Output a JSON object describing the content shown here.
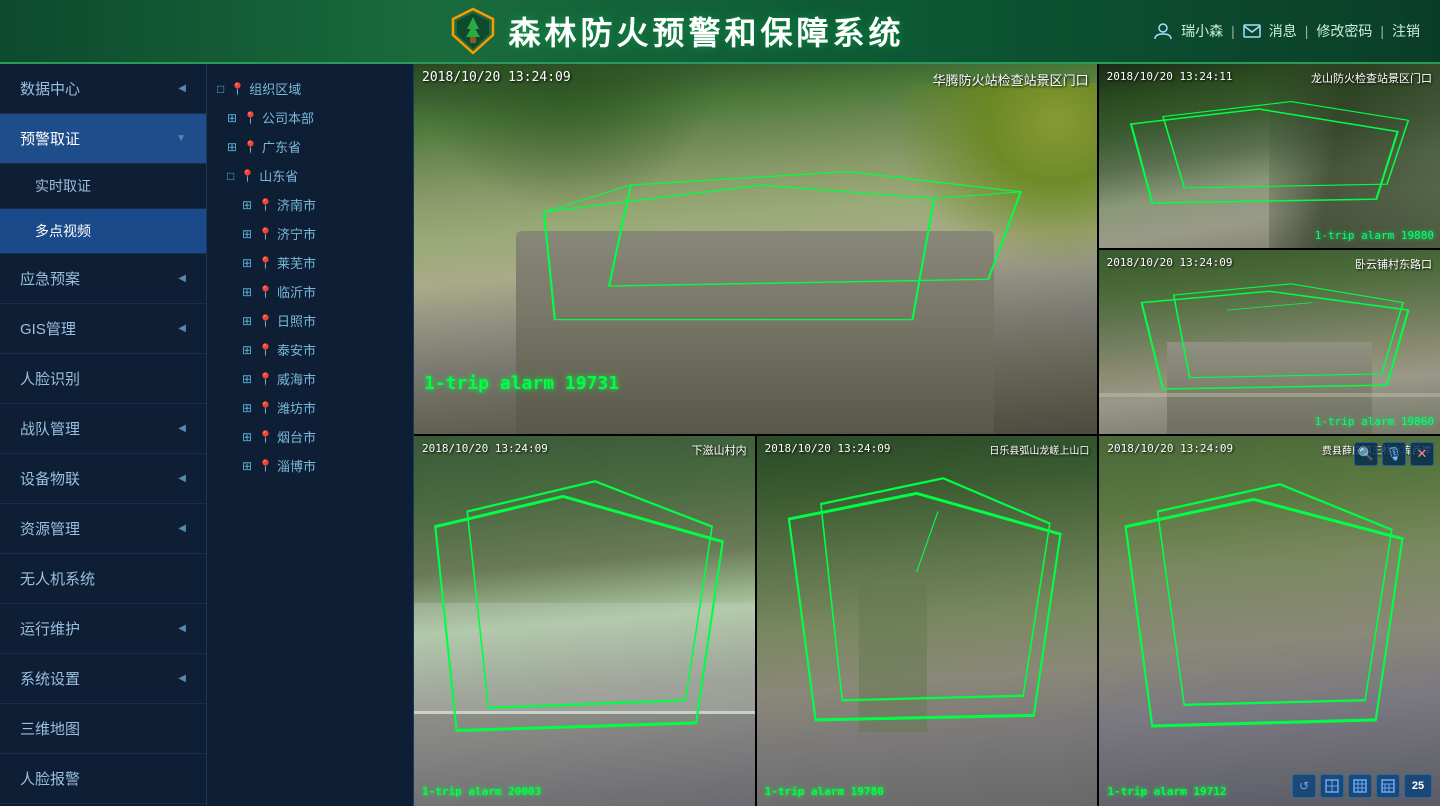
{
  "header": {
    "title": "森林防火预警和保障系统",
    "user": "瑞小森",
    "messages": "消息",
    "change_pwd": "修改密码",
    "logout": "注销"
  },
  "sidebar": {
    "items": [
      {
        "label": "数据中心",
        "arrow": "◀",
        "active": false
      },
      {
        "label": "预警取证",
        "arrow": "▼",
        "active": true
      },
      {
        "label": "实时取证",
        "arrow": "",
        "active": false,
        "sub": true
      },
      {
        "label": "多点视频",
        "arrow": "",
        "active": true,
        "sub": true
      },
      {
        "label": "应急预案",
        "arrow": "◀",
        "active": false
      },
      {
        "label": "GIS管理",
        "arrow": "◀",
        "active": false
      },
      {
        "label": "人脸识别",
        "arrow": "",
        "active": false
      },
      {
        "label": "战队管理",
        "arrow": "◀",
        "active": false
      },
      {
        "label": "设备物联",
        "arrow": "◀",
        "active": false
      },
      {
        "label": "资源管理",
        "arrow": "◀",
        "active": false
      },
      {
        "label": "无人机系统",
        "arrow": "",
        "active": false
      },
      {
        "label": "运行维护",
        "arrow": "◀",
        "active": false
      },
      {
        "label": "系统设置",
        "arrow": "◀",
        "active": false
      },
      {
        "label": "三维地图",
        "arrow": "",
        "active": false
      },
      {
        "label": "人脸报警",
        "arrow": "",
        "active": false
      }
    ]
  },
  "tree": {
    "nodes": [
      {
        "label": "组织区域",
        "indent": 1,
        "expand": "□",
        "type": "root"
      },
      {
        "label": "公司本部",
        "indent": 2,
        "expand": "⊞",
        "type": "loc"
      },
      {
        "label": "广东省",
        "indent": 2,
        "expand": "⊞",
        "type": "loc"
      },
      {
        "label": "山东省",
        "indent": 2,
        "expand": "□",
        "type": "loc"
      },
      {
        "label": "济南市",
        "indent": 3,
        "expand": "⊞",
        "type": "loc"
      },
      {
        "label": "济宁市",
        "indent": 3,
        "expand": "⊞",
        "type": "loc"
      },
      {
        "label": "莱芜市",
        "indent": 3,
        "expand": "⊞",
        "type": "loc"
      },
      {
        "label": "临沂市",
        "indent": 3,
        "expand": "⊞",
        "type": "loc"
      },
      {
        "label": "日照市",
        "indent": 3,
        "expand": "⊞",
        "type": "loc"
      },
      {
        "label": "泰安市",
        "indent": 3,
        "expand": "⊞",
        "type": "loc"
      },
      {
        "label": "威海市",
        "indent": 3,
        "expand": "⊞",
        "type": "loc"
      },
      {
        "label": "潍坊市",
        "indent": 3,
        "expand": "⊞",
        "type": "loc"
      },
      {
        "label": "烟台市",
        "indent": 3,
        "expand": "⊞",
        "type": "loc"
      },
      {
        "label": "淄博市",
        "indent": 3,
        "expand": "⊞",
        "type": "loc"
      }
    ]
  },
  "cameras": {
    "main": {
      "timestamp": "2018/10/20  13:24:09",
      "title": "华腾防火站检查站景区门口",
      "alarm": "1-trip alarm 19731"
    },
    "top_right_1": {
      "timestamp": "2018/10/20  13:24:11",
      "title": "龙山防火检查站景区门口",
      "alarm": "1-trip alarm 19880"
    },
    "top_right_2": {
      "timestamp": "2018/10/20  13:24:09",
      "title": "卧云铺村东路口",
      "alarm": "1-trip alarm 19860"
    },
    "bottom_left": {
      "timestamp": "2018/10/20  13:24:09",
      "title": "下滋山村内",
      "alarm": "1-trip alarm 20003"
    },
    "bottom_mid": {
      "timestamp": "2018/10/20  13:24:09",
      "title": "日乐县弧山龙嵯上山口",
      "alarm": "1-trip alarm 19780"
    },
    "bottom_right": {
      "timestamp": "2018/10/20  13:24:09",
      "title": "费县薛庄镇王林水库西岸",
      "alarm": "1-trip alarm 19712"
    }
  },
  "toolbar": {
    "refresh_icon": "↺",
    "layout1_icon": "▣",
    "layout2_icon": "⊞",
    "layout3_icon": "⊟",
    "layout4_icon": "⊠",
    "fullscreen_icon": "25",
    "search_icon": "🔍",
    "mic_icon": "🎙",
    "close_icon": "✕"
  }
}
